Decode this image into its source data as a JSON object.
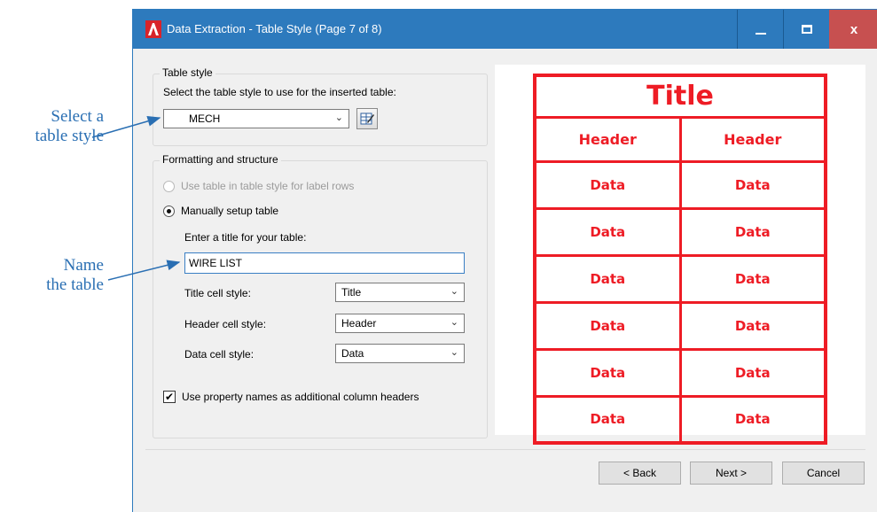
{
  "annotations": {
    "select_style": [
      "Select a",
      "table style"
    ],
    "name_table": [
      "Name",
      "the table"
    ]
  },
  "window": {
    "title": "Data Extraction - Table Style (Page 7 of 8)",
    "close_glyph": "x"
  },
  "table_style": {
    "group_title": "Table style",
    "prompt": "Select the table style to use for the inserted table:",
    "selected": "MECH"
  },
  "formatting": {
    "group_title": "Formatting and structure",
    "radio_label_rows": "Use table in table style for label rows",
    "radio_manual": "Manually setup table",
    "title_prompt": "Enter a title for your table:",
    "title_value": "WIRE LIST",
    "title_cell_label": "Title cell style:",
    "title_cell_value": "Title",
    "header_cell_label": "Header cell style:",
    "header_cell_value": "Header",
    "data_cell_label": "Data cell style:",
    "data_cell_value": "Data",
    "checkbox_label": "Use property names as additional column headers",
    "checkbox_checked": true
  },
  "preview": {
    "title": "Title",
    "header": "Header",
    "data": "Data",
    "color": "#ee1c25"
  },
  "buttons": {
    "back": "< Back",
    "next": "Next >",
    "cancel": "Cancel"
  },
  "colors": {
    "titlebar": "#2d7abd",
    "close": "#c75050",
    "annotation": "#2a6fb3"
  }
}
